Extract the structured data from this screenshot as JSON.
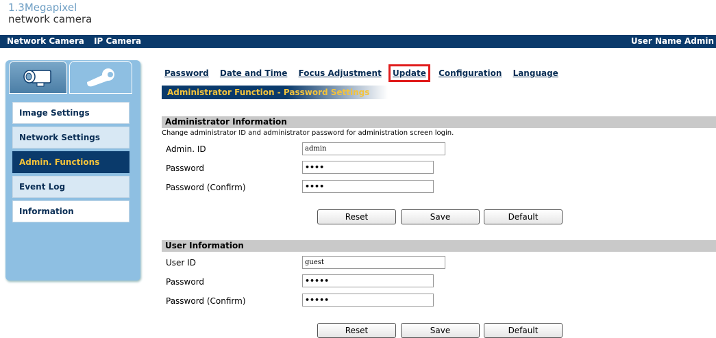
{
  "brand": {
    "line1": "1.3Megapixel",
    "line2": "network camera"
  },
  "topbar": {
    "left_items": [
      "Network Camera",
      "IP Camera"
    ],
    "user": "User Name Admin"
  },
  "sidebar": {
    "items": [
      {
        "label": "Image Settings",
        "state": "normal"
      },
      {
        "label": "Network Settings",
        "state": "alt"
      },
      {
        "label": "Admin. Functions",
        "state": "active"
      },
      {
        "label": "Event Log",
        "state": "alt"
      },
      {
        "label": "Information",
        "state": "normal"
      }
    ]
  },
  "nav": {
    "items": [
      "Password",
      "Date and Time",
      "Focus Adjustment",
      "Update",
      "Configuration",
      "Language"
    ],
    "highlighted": "Update"
  },
  "section_title": "Administrator Function - Password Settings",
  "admin": {
    "title": "Administrator Information",
    "description": "Change administrator ID and administrator password for administration screen login.",
    "id_label": "Admin. ID",
    "id_value": "admin",
    "password_label": "Password",
    "password_value": "••••",
    "confirm_label": "Password (Confirm)",
    "confirm_value": "••••"
  },
  "user": {
    "title": "User Information",
    "id_label": "User ID",
    "id_value": "guest",
    "password_label": "Password",
    "password_value": "•••••",
    "confirm_label": "Password (Confirm)",
    "confirm_value": "•••••"
  },
  "buttons": {
    "reset": "Reset",
    "save": "Save",
    "default": "Default"
  },
  "colors": {
    "navy": "#0a3a6b",
    "gold": "#f3c33b",
    "sidebar": "#8ebfe2",
    "highlight": "#e01b1b"
  },
  "icons": [
    "camera-icon",
    "wrench-icon"
  ]
}
